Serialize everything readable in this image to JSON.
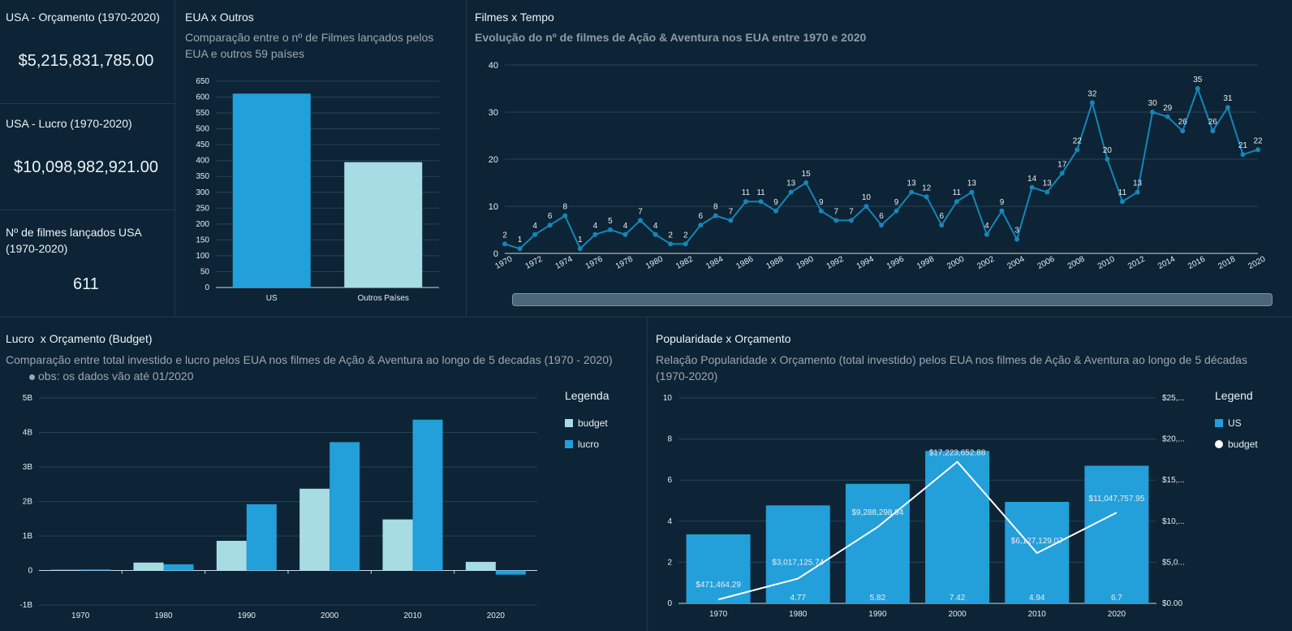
{
  "kpis": [
    {
      "title": "USA - Orçamento (1970-2020)",
      "value": "$5,215,831,785.00"
    },
    {
      "title": "USA - Lucro (1970-2020)",
      "value": "$10,098,982,921.00"
    },
    {
      "title": "Nº de filmes lançados USA (1970-2020)",
      "value": "611"
    }
  ],
  "colors": {
    "background": "#0c2435",
    "blue": "#239fda",
    "light": "#a8dce3",
    "line": "#1586b8",
    "white": "#ffffff"
  },
  "chart_data": [
    {
      "id": "eua-outros",
      "type": "bar",
      "title": "EUA x Outros",
      "subtitle": "Comparação entre o nº de Filmes lançados pelos EUA e outros 59 países",
      "categories": [
        "US",
        "Outros Países"
      ],
      "values": [
        611,
        395
      ],
      "ylim": [
        0,
        650
      ],
      "yticks": [
        "0",
        "50",
        "100",
        "150",
        "200",
        "250",
        "300",
        "350",
        "400",
        "450",
        "500",
        "550",
        "600",
        "650"
      ],
      "grid": true
    },
    {
      "id": "filmes-tempo",
      "type": "line",
      "title": "Filmes x Tempo",
      "subtitle": "Evolução do nº de filmes de Ação & Aventura nos EUA entre 1970 e 2020",
      "x": [
        1970,
        1971,
        1972,
        1973,
        1974,
        1975,
        1976,
        1977,
        1978,
        1979,
        1980,
        1981,
        1982,
        1983,
        1984,
        1985,
        1986,
        1987,
        1988,
        1989,
        1990,
        1991,
        1992,
        1993,
        1994,
        1995,
        1996,
        1997,
        1998,
        1999,
        2000,
        2001,
        2002,
        2003,
        2004,
        2005,
        2006,
        2007,
        2008,
        2009,
        2010,
        2011,
        2012,
        2013,
        2014,
        2015,
        2016,
        2017,
        2018,
        2019,
        2020
      ],
      "values": [
        2,
        1,
        4,
        6,
        8,
        1,
        4,
        5,
        4,
        7,
        4,
        2,
        2,
        6,
        8,
        7,
        11,
        11,
        9,
        13,
        15,
        9,
        7,
        7,
        10,
        6,
        9,
        13,
        12,
        6,
        11,
        13,
        4,
        9,
        3,
        14,
        13,
        17,
        22,
        32,
        20,
        11,
        13,
        30,
        29,
        26,
        35,
        26,
        31,
        21,
        22
      ],
      "xticks": [
        "1970",
        "1972",
        "1974",
        "1976",
        "1978",
        "1980",
        "1982",
        "1984",
        "1986",
        "1988",
        "1990",
        "1992",
        "1994",
        "1996",
        "1998",
        "2000",
        "2002",
        "2004",
        "2006",
        "2008",
        "2010",
        "2012",
        "2014",
        "2016",
        "2018",
        "2020"
      ],
      "yticks": [
        "0",
        "10",
        "20",
        "30",
        "40"
      ],
      "ylim": [
        0,
        40
      ],
      "grid": true
    },
    {
      "id": "lucro-orcamento",
      "type": "bar",
      "title": "Lucro  x Orçamento (Budget)",
      "subtitle": "Comparação entre total investido e lucro pelos EUA nos filmes de Ação & Aventura ao longo de 5 decadas (1970 - 2020)",
      "note": "obs: os dados vão até 01/2020",
      "categories": [
        "1970",
        "1980",
        "1990",
        "2000",
        "2010",
        "2020"
      ],
      "series": [
        {
          "name": "budget",
          "values": [
            0.02,
            0.23,
            0.86,
            2.37,
            1.48,
            0.25
          ]
        },
        {
          "name": "lucro",
          "values": [
            0.03,
            0.18,
            1.92,
            3.72,
            4.37,
            -0.12
          ]
        }
      ],
      "unit": "B",
      "ylim": [
        -1,
        5
      ],
      "yticks": [
        "-1B",
        "0",
        "1B",
        "2B",
        "3B",
        "4B",
        "5B"
      ],
      "legend_title": "Legenda",
      "legend": "right",
      "grid": true
    },
    {
      "id": "popularidade-orcamento",
      "type": "bar",
      "title": "Popularidade x Orçamento",
      "subtitle": "Relação Popularidade x Orçamento (total investido) pelos EUA nos filmes de Ação & Aventura ao longo de 5 décadas (1970-2020)",
      "categories": [
        "1970",
        "1980",
        "1990",
        "2000",
        "2010",
        "2020"
      ],
      "series": [
        {
          "name": "US",
          "type": "bar",
          "values": [
            3.36,
            4.77,
            5.82,
            7.42,
            4.94,
            6.7
          ],
          "labels": [
            "",
            "4.77",
            "5.82",
            "7.42",
            "4.94",
            "6.7"
          ]
        },
        {
          "name": "budget",
          "type": "line",
          "values": [
            471464.29,
            3017125.74,
            9288298.94,
            17223652.88,
            6127129.07,
            11047757.95
          ],
          "labels": [
            "$471,464.29",
            "$3,017,125.74",
            "$9,288,298.94",
            "$17,223,652.88",
            "$6,127,129.07",
            "$11,047,757.95"
          ]
        }
      ],
      "ylim": [
        0,
        10
      ],
      "yticks": [
        "0",
        "2",
        "4",
        "6",
        "8",
        "10"
      ],
      "y2lim": [
        0,
        25000000
      ],
      "y2ticks": [
        "$0.00",
        "$5,0...",
        "$10,...",
        "$15,...",
        "$20,...",
        "$25,..."
      ],
      "legend_title": "Legend",
      "legend": "right",
      "grid": true
    }
  ]
}
